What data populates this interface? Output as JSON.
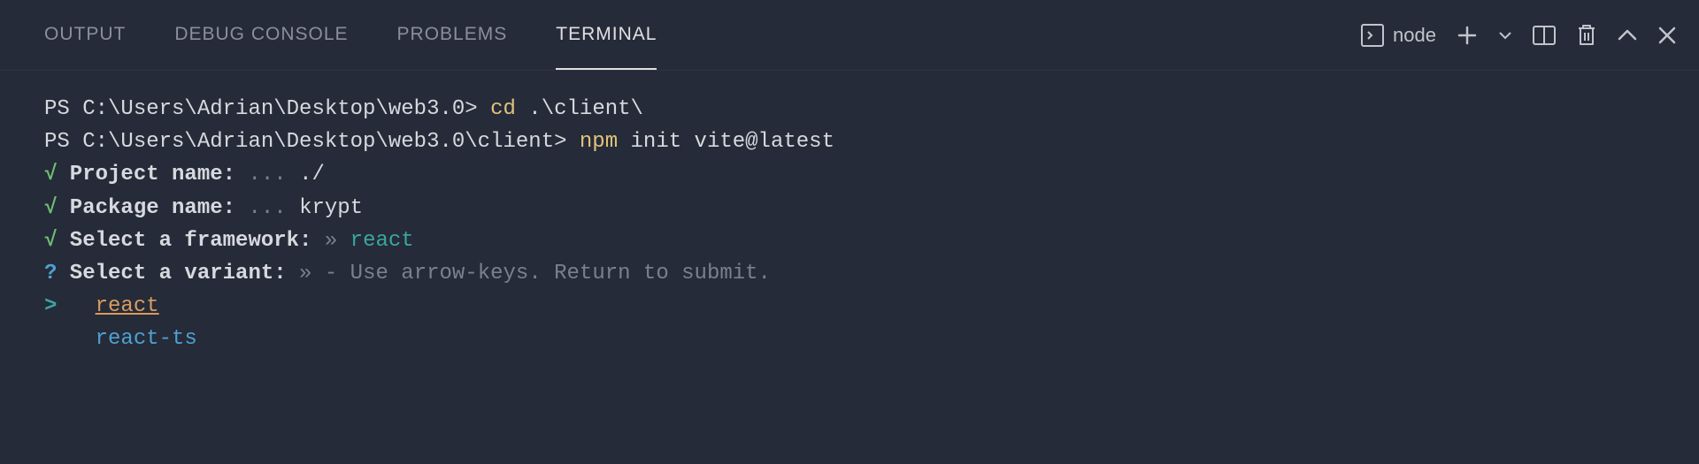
{
  "tabs": {
    "output": "OUTPUT",
    "debug_console": "DEBUG CONSOLE",
    "problems": "PROBLEMS",
    "terminal": "TERMINAL"
  },
  "toolbar": {
    "shell_name": "node"
  },
  "terminal": {
    "line1": {
      "prompt": "PS C:\\Users\\Adrian\\Desktop\\web3.0> ",
      "cmd_bin": "cd",
      "cmd_arg": " .\\client\\"
    },
    "line2": {
      "prompt": "PS C:\\Users\\Adrian\\Desktop\\web3.0\\client> ",
      "cmd_bin": "npm",
      "cmd_arg": " init vite@latest"
    },
    "line3": {
      "check": "√",
      "question": " Project name:",
      "dots": " ... ",
      "answer": "./"
    },
    "line4": {
      "check": "√",
      "question": " Package name:",
      "dots": " ... ",
      "answer": "krypt"
    },
    "line5": {
      "check": "√",
      "question": " Select a framework:",
      "sep": " » ",
      "answer": "react"
    },
    "line6": {
      "qmark": "?",
      "question": " Select a variant:",
      "sep": " » ",
      "hint": "- Use arrow-keys. Return to submit."
    },
    "line7": {
      "arrow": ">",
      "pad": "   ",
      "option": "react"
    },
    "line8": {
      "pad": "    ",
      "option": "react-ts"
    }
  }
}
